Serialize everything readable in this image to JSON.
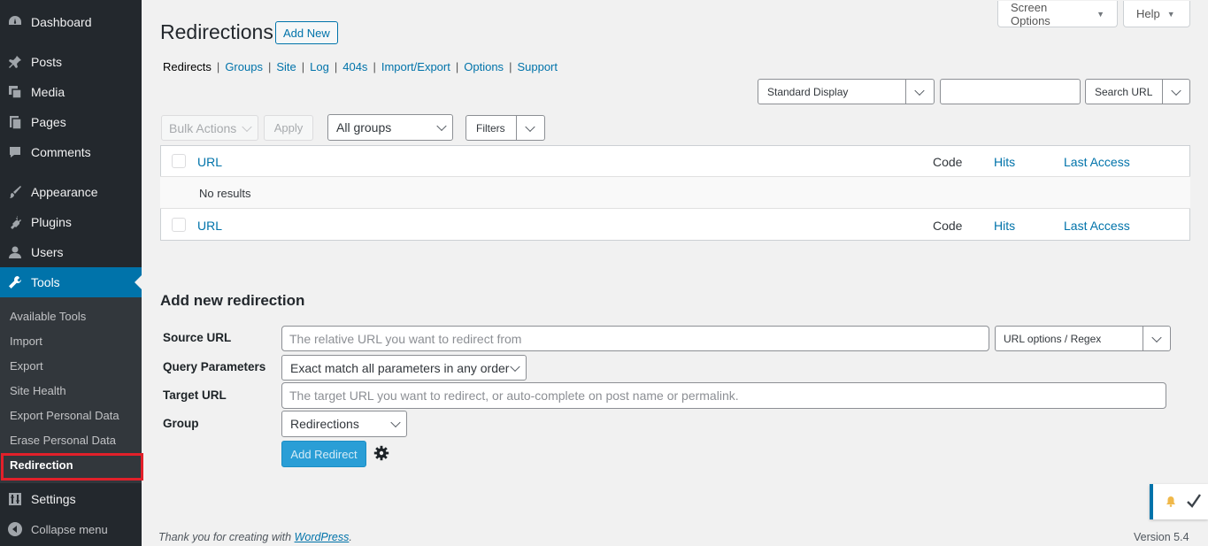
{
  "sidebar": {
    "items": [
      {
        "label": "Dashboard",
        "icon": "dashboard-icon"
      },
      {
        "label": "Posts",
        "icon": "pin-icon"
      },
      {
        "label": "Media",
        "icon": "media-icon"
      },
      {
        "label": "Pages",
        "icon": "pages-icon"
      },
      {
        "label": "Comments",
        "icon": "comment-icon"
      },
      {
        "label": "Appearance",
        "icon": "brush-icon"
      },
      {
        "label": "Plugins",
        "icon": "plugin-icon"
      },
      {
        "label": "Users",
        "icon": "users-icon"
      },
      {
        "label": "Tools",
        "icon": "wrench-icon"
      },
      {
        "label": "Settings",
        "icon": "settings-icon"
      },
      {
        "label": "Collapse menu",
        "icon": "collapse-icon"
      }
    ],
    "submenu": [
      "Available Tools",
      "Import",
      "Export",
      "Site Health",
      "Export Personal Data",
      "Erase Personal Data",
      "Redirection"
    ]
  },
  "header": {
    "screen_options": "Screen Options",
    "help": "Help",
    "title": "Redirections",
    "add_new": "Add New"
  },
  "subnav": {
    "current": "Redirects",
    "links": [
      "Groups",
      "Site",
      "Log",
      "404s",
      "Import/Export",
      "Options",
      "Support"
    ],
    "separator": "|"
  },
  "search": {
    "display_select": "Standard Display",
    "input_value": "",
    "search_button": "Search URL"
  },
  "toolbar": {
    "bulk_actions": "Bulk Actions",
    "apply": "Apply",
    "groups_select": "All groups",
    "filters": "Filters"
  },
  "table": {
    "columns": [
      "URL",
      "Code",
      "Hits",
      "Last Access"
    ],
    "empty": "No results"
  },
  "form": {
    "heading": "Add new redirection",
    "source_label": "Source URL",
    "source_placeholder": "The relative URL you want to redirect from",
    "url_options": "URL options / Regex",
    "query_label": "Query Parameters",
    "query_value": "Exact match all parameters in any order",
    "target_label": "Target URL",
    "target_placeholder": "The target URL you want to redirect, or auto-complete on post name or permalink.",
    "group_label": "Group",
    "group_value": "Redirections",
    "submit": "Add Redirect"
  },
  "footer": {
    "thanks": "Thank you for creating with",
    "wp_link": "WordPress",
    "period": ".",
    "version": "Version 5.4"
  },
  "colors": {
    "sidebar_bg": "#23282d",
    "submenu_bg": "#32373c",
    "accent": "#0073aa",
    "highlight_box": "#e2202a",
    "notice_bell": "#f0b849"
  }
}
